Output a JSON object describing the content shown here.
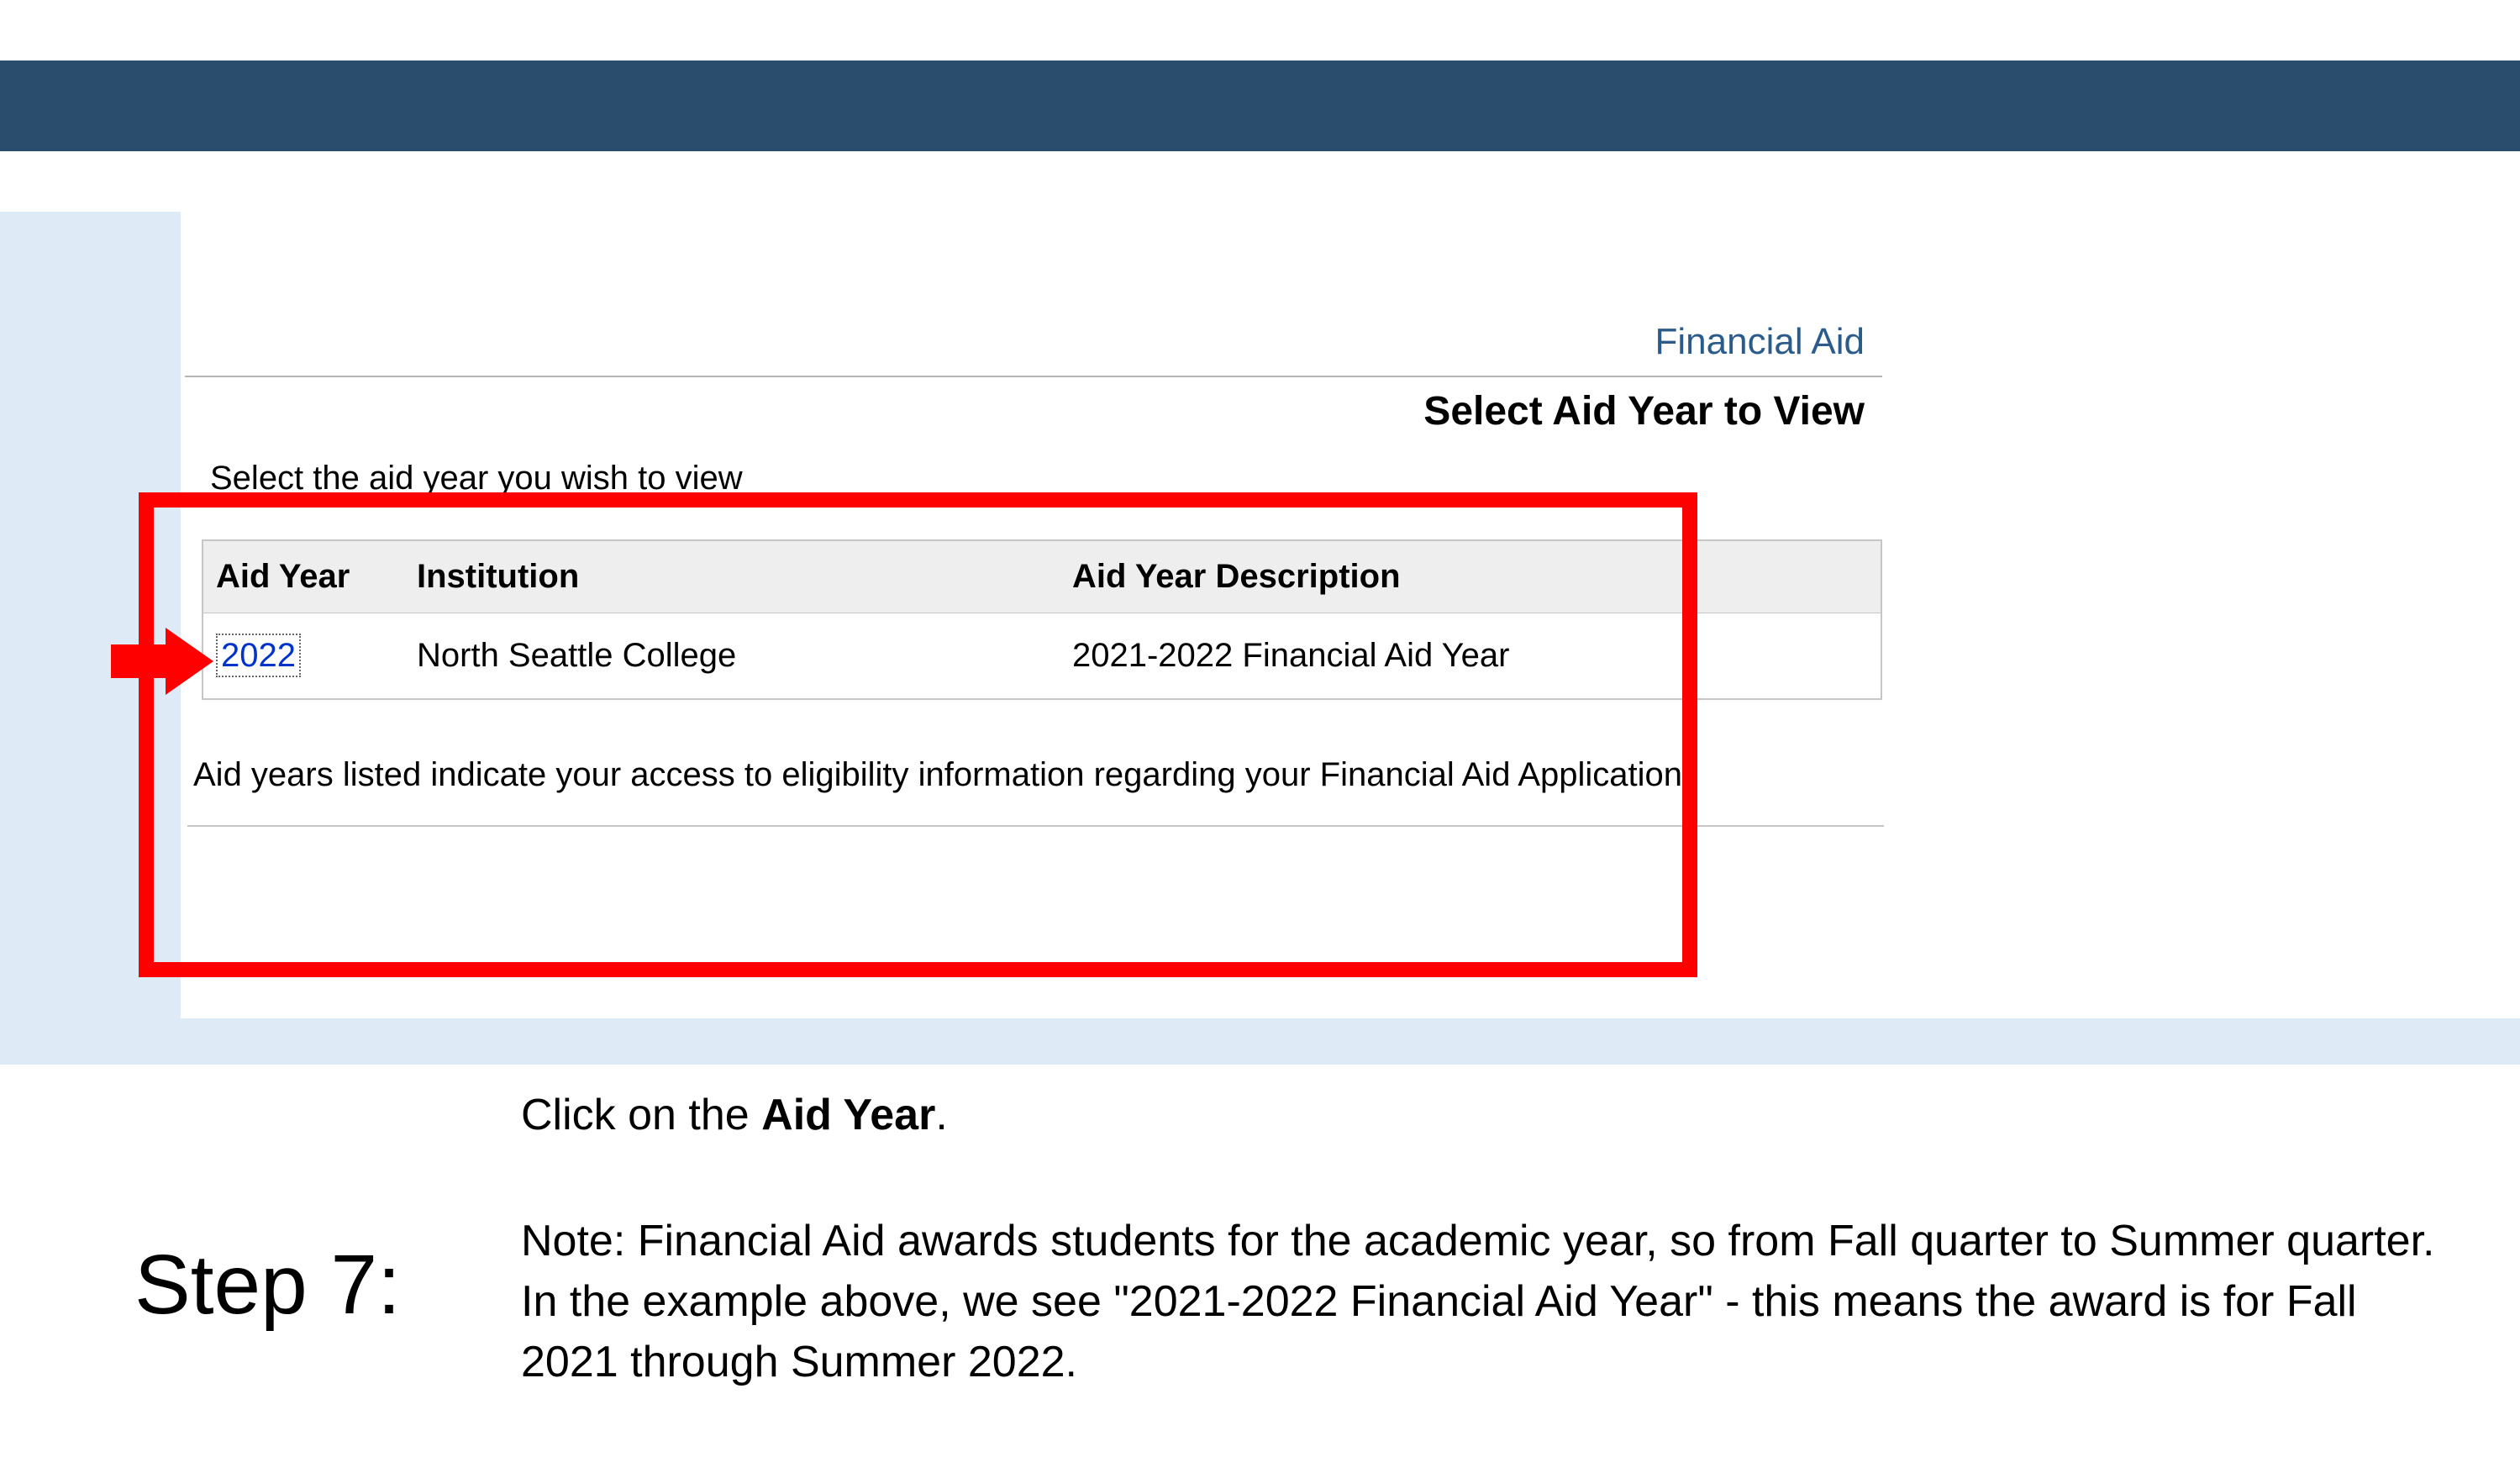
{
  "header": {
    "breadcrumb": "Financial Aid",
    "page_title": "Select Aid Year to View"
  },
  "content": {
    "instruction": "Select the aid year you wish to view",
    "table": {
      "headers": {
        "aid_year": "Aid Year",
        "institution": "Institution",
        "description": "Aid Year Description"
      },
      "row": {
        "aid_year": "2022",
        "institution": "North Seattle College",
        "description": "2021-2022 Financial Aid Year"
      }
    },
    "footer_text": "Aid years listed indicate your access to eligibility information regarding your Financial Aid Application."
  },
  "tutorial": {
    "step_label": "Step 7:",
    "instruction_prefix": "Click on the ",
    "instruction_bold": "Aid Year",
    "instruction_suffix": ".",
    "note": "Note: Financial Aid awards students for the academic year, so from Fall quarter to Summer quarter. In the example above, we see \"2021-2022 Financial Aid Year\" - this means the award is for Fall 2021 through Summer 2022."
  }
}
